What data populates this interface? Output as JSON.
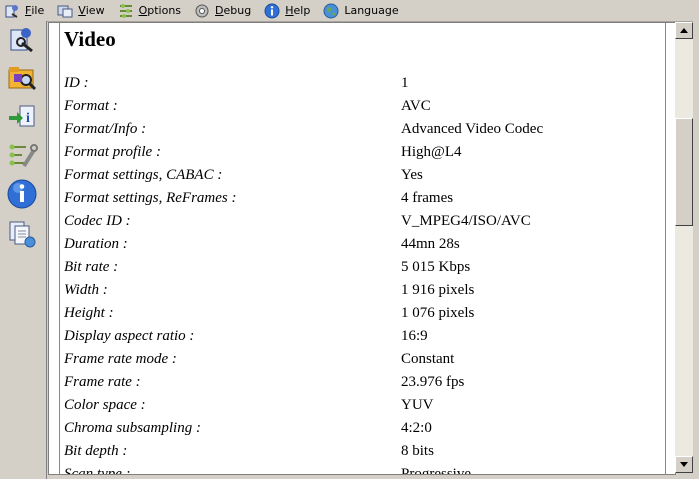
{
  "menu": [
    {
      "icon": "file-icon",
      "accel": "F",
      "rest": "ile"
    },
    {
      "icon": "view-icon",
      "accel": "V",
      "rest": "iew"
    },
    {
      "icon": "options-icon",
      "accel": "O",
      "rest": "ptions"
    },
    {
      "icon": "debug-icon",
      "accel": "D",
      "rest": "ebug"
    },
    {
      "icon": "help-icon",
      "accel": "H",
      "rest": "elp"
    },
    {
      "icon": "language-icon",
      "accel": "",
      "rest": "Language"
    }
  ],
  "toolbar": [
    "open-file-icon",
    "open-folder-icon",
    "export-icon",
    "preferences-icon",
    "about-icon",
    "sheet-view-icon"
  ],
  "section_title": "Video",
  "rows": [
    {
      "key": "ID :",
      "value": "1"
    },
    {
      "key": "Format :",
      "value": "AVC"
    },
    {
      "key": "Format/Info :",
      "value": "Advanced Video Codec"
    },
    {
      "key": "Format profile :",
      "value": "High@L4"
    },
    {
      "key": "Format settings, CABAC :",
      "value": "Yes"
    },
    {
      "key": "Format settings, ReFrames :",
      "value": "4 frames"
    },
    {
      "key": "Codec ID :",
      "value": "V_MPEG4/ISO/AVC"
    },
    {
      "key": "Duration :",
      "value": "44mn 28s"
    },
    {
      "key": "Bit rate :",
      "value": "5 015 Kbps"
    },
    {
      "key": "Width :",
      "value": "1 916 pixels"
    },
    {
      "key": "Height :",
      "value": "1 076 pixels"
    },
    {
      "key": "Display aspect ratio :",
      "value": "16:9"
    },
    {
      "key": "Frame rate mode :",
      "value": "Constant"
    },
    {
      "key": "Frame rate :",
      "value": "23.976 fps"
    },
    {
      "key": "Color space :",
      "value": "YUV"
    },
    {
      "key": "Chroma subsampling :",
      "value": "4:2:0"
    },
    {
      "key": "Bit depth :",
      "value": "8 bits"
    },
    {
      "key": "Scan type :",
      "value": "Progressive"
    }
  ]
}
